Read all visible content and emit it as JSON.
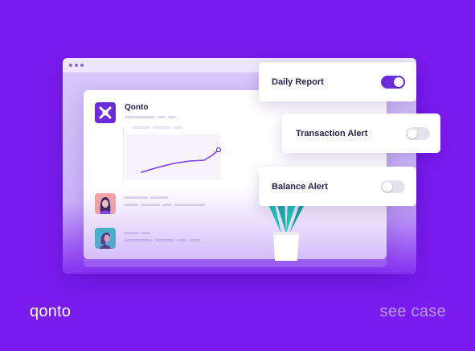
{
  "app": {
    "brand_name": "Qonto"
  },
  "alerts": [
    {
      "label": "Daily Report",
      "enabled": true
    },
    {
      "label": "Transaction Alert",
      "enabled": false
    },
    {
      "label": "Balance Alert",
      "enabled": false
    }
  ],
  "footer": {
    "brand": "qonto",
    "link_label": "see case"
  },
  "colors": {
    "background": "#7a1cf0",
    "accent": "#6b2bd9",
    "teal": "#1ec7b5",
    "coral": "#f4a7a0",
    "link": "#b79af4"
  },
  "icons": {
    "logo": "qonto-logo-icon",
    "plant": "plant-icon"
  }
}
